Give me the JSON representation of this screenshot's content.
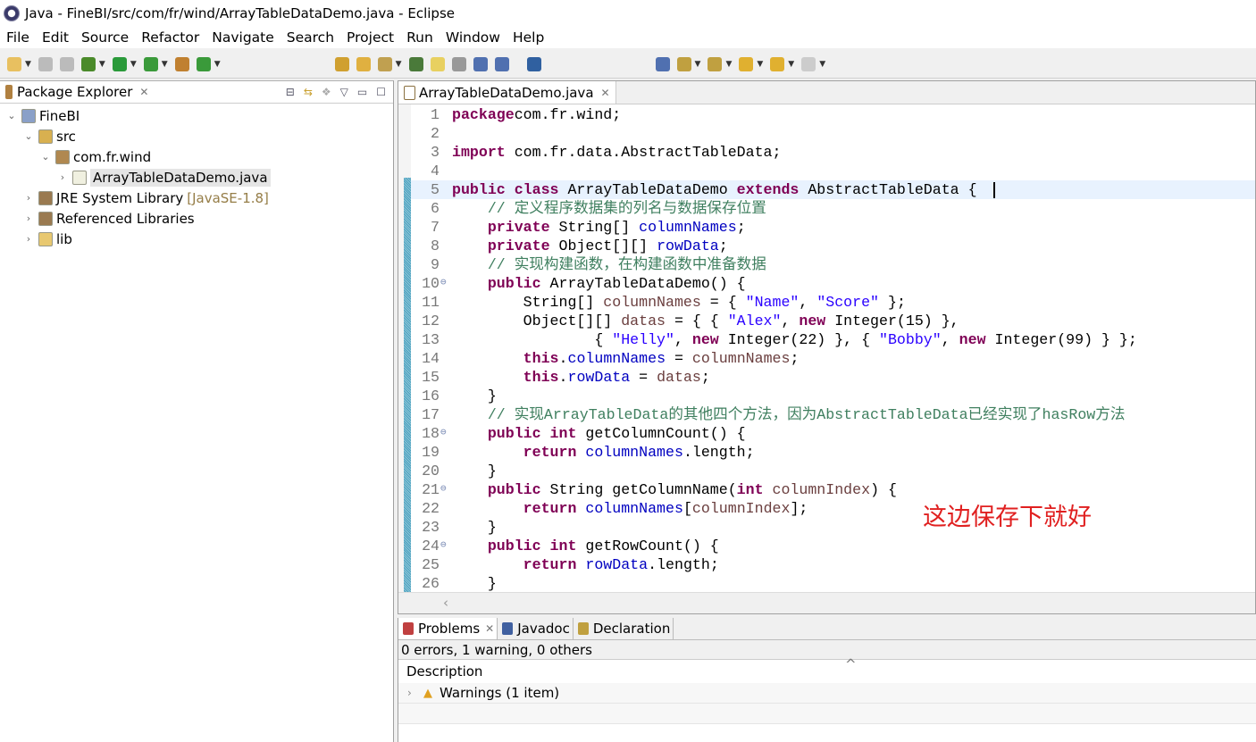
{
  "window": {
    "title": "Java - FineBI/src/com/fr/wind/ArrayTableDataDemo.java - Eclipse"
  },
  "menu": [
    "File",
    "Edit",
    "Source",
    "Refactor",
    "Navigate",
    "Search",
    "Project",
    "Run",
    "Window",
    "Help"
  ],
  "package_explorer": {
    "title": "Package Explorer",
    "tree": [
      {
        "label": "FineBI",
        "level": 0,
        "expanded": true,
        "icon": "project-icon"
      },
      {
        "label": "src",
        "level": 1,
        "expanded": true,
        "icon": "source-folder-icon"
      },
      {
        "label": "com.fr.wind",
        "level": 2,
        "expanded": true,
        "icon": "package-icon"
      },
      {
        "label": "ArrayTableDataDemo.java",
        "level": 3,
        "expanded": false,
        "icon": "java-file-icon",
        "selected": true
      },
      {
        "label": "JRE System Library",
        "decoration": "[JavaSE-1.8]",
        "level": 1,
        "expanded": false,
        "icon": "library-icon"
      },
      {
        "label": "Referenced Libraries",
        "level": 1,
        "expanded": false,
        "icon": "library-icon"
      },
      {
        "label": "lib",
        "level": 1,
        "expanded": false,
        "icon": "folder-icon"
      }
    ]
  },
  "editor": {
    "tab": "ArrayTableDataDemo.java",
    "current_line": 5,
    "lines": [
      [
        [
          "kw",
          "package"
        ],
        [
          "",
          "com.fr.wind;"
        ]
      ],
      [],
      [
        [
          "kw",
          "import"
        ],
        [
          "",
          " com.fr.data.AbstractTableData;"
        ]
      ],
      [],
      [
        [
          "kw",
          "public class"
        ],
        [
          "",
          " ArrayTableDataDemo "
        ],
        [
          "kw",
          "extends"
        ],
        [
          "",
          " AbstractTableData {"
        ]
      ],
      [
        [
          "",
          "    "
        ],
        [
          "cmt",
          "// 定义程序数据集的列名与数据保存位置"
        ]
      ],
      [
        [
          "",
          "    "
        ],
        [
          "kw",
          "private"
        ],
        [
          "",
          " String[] "
        ],
        [
          "fld",
          "columnNames"
        ],
        [
          "",
          ";"
        ]
      ],
      [
        [
          "",
          "    "
        ],
        [
          "kw",
          "private"
        ],
        [
          "",
          " Object[][] "
        ],
        [
          "fld",
          "rowData"
        ],
        [
          "",
          ";"
        ]
      ],
      [
        [
          "",
          "    "
        ],
        [
          "cmt",
          "// 实现构建函数，在构建函数中准备数据"
        ]
      ],
      [
        [
          "",
          "    "
        ],
        [
          "kw",
          "public"
        ],
        [
          "",
          " ArrayTableDataDemo() {"
        ]
      ],
      [
        [
          "",
          "        String[] "
        ],
        [
          "par",
          "columnNames"
        ],
        [
          "",
          " = { "
        ],
        [
          "str",
          "\"Name\""
        ],
        [
          "",
          ", "
        ],
        [
          "str",
          "\"Score\""
        ],
        [
          "",
          " };"
        ]
      ],
      [
        [
          "",
          "        Object[][] "
        ],
        [
          "par",
          "datas"
        ],
        [
          "",
          " = { { "
        ],
        [
          "str",
          "\"Alex\""
        ],
        [
          "",
          ", "
        ],
        [
          "kw",
          "new"
        ],
        [
          "",
          " Integer(15) },"
        ]
      ],
      [
        [
          "",
          "                { "
        ],
        [
          "str",
          "\"Helly\""
        ],
        [
          "",
          ", "
        ],
        [
          "kw",
          "new"
        ],
        [
          "",
          " Integer(22) }, { "
        ],
        [
          "str",
          "\"Bobby\""
        ],
        [
          "",
          ", "
        ],
        [
          "kw",
          "new"
        ],
        [
          "",
          " Integer(99) } };"
        ]
      ],
      [
        [
          "",
          "        "
        ],
        [
          "kw",
          "this"
        ],
        [
          "",
          "."
        ],
        [
          "fld",
          "columnNames"
        ],
        [
          "",
          " = "
        ],
        [
          "par",
          "columnNames"
        ],
        [
          "",
          ";"
        ]
      ],
      [
        [
          "",
          "        "
        ],
        [
          "kw",
          "this"
        ],
        [
          "",
          "."
        ],
        [
          "fld",
          "rowData"
        ],
        [
          "",
          " = "
        ],
        [
          "par",
          "datas"
        ],
        [
          "",
          ";"
        ]
      ],
      [
        [
          "",
          "    }"
        ]
      ],
      [
        [
          "",
          "    "
        ],
        [
          "cmt",
          "// 实现ArrayTableData的其他四个方法，因为AbstractTableData已经实现了hasRow方法"
        ]
      ],
      [
        [
          "",
          "    "
        ],
        [
          "kw",
          "public int"
        ],
        [
          "",
          " getColumnCount() {"
        ]
      ],
      [
        [
          "",
          "        "
        ],
        [
          "kw",
          "return"
        ],
        [
          "",
          " "
        ],
        [
          "fld",
          "columnNames"
        ],
        [
          "",
          ".length;"
        ]
      ],
      [
        [
          "",
          "    }"
        ]
      ],
      [
        [
          "",
          "    "
        ],
        [
          "kw",
          "public"
        ],
        [
          "",
          " String getColumnName("
        ],
        [
          "kw",
          "int"
        ],
        [
          "",
          " "
        ],
        [
          "par",
          "columnIndex"
        ],
        [
          "",
          ") {"
        ]
      ],
      [
        [
          "",
          "        "
        ],
        [
          "kw",
          "return"
        ],
        [
          "",
          " "
        ],
        [
          "fld",
          "columnNames"
        ],
        [
          "",
          "["
        ],
        [
          "par",
          "columnIndex"
        ],
        [
          "",
          "];"
        ]
      ],
      [
        [
          "",
          "    }"
        ]
      ],
      [
        [
          "",
          "    "
        ],
        [
          "kw",
          "public int"
        ],
        [
          "",
          " getRowCount() {"
        ]
      ],
      [
        [
          "",
          "        "
        ],
        [
          "kw",
          "return"
        ],
        [
          "",
          " "
        ],
        [
          "fld",
          "rowData"
        ],
        [
          "",
          ".length;"
        ]
      ],
      [
        [
          "",
          "    }"
        ]
      ]
    ],
    "folded_lines": [
      10,
      18,
      21,
      24
    ],
    "annotation": "这边保存下就好"
  },
  "problems": {
    "tabs": [
      "Problems",
      "Javadoc",
      "Declaration"
    ],
    "summary": "0 errors, 1 warning, 0 others",
    "column": "Description",
    "rows": [
      "Warnings (1 item)"
    ]
  },
  "colors": {
    "keyword": "#7f0055",
    "field": "#0000c0",
    "string": "#2a00ff",
    "comment": "#3f7f5f",
    "annotation": "#e02020"
  }
}
